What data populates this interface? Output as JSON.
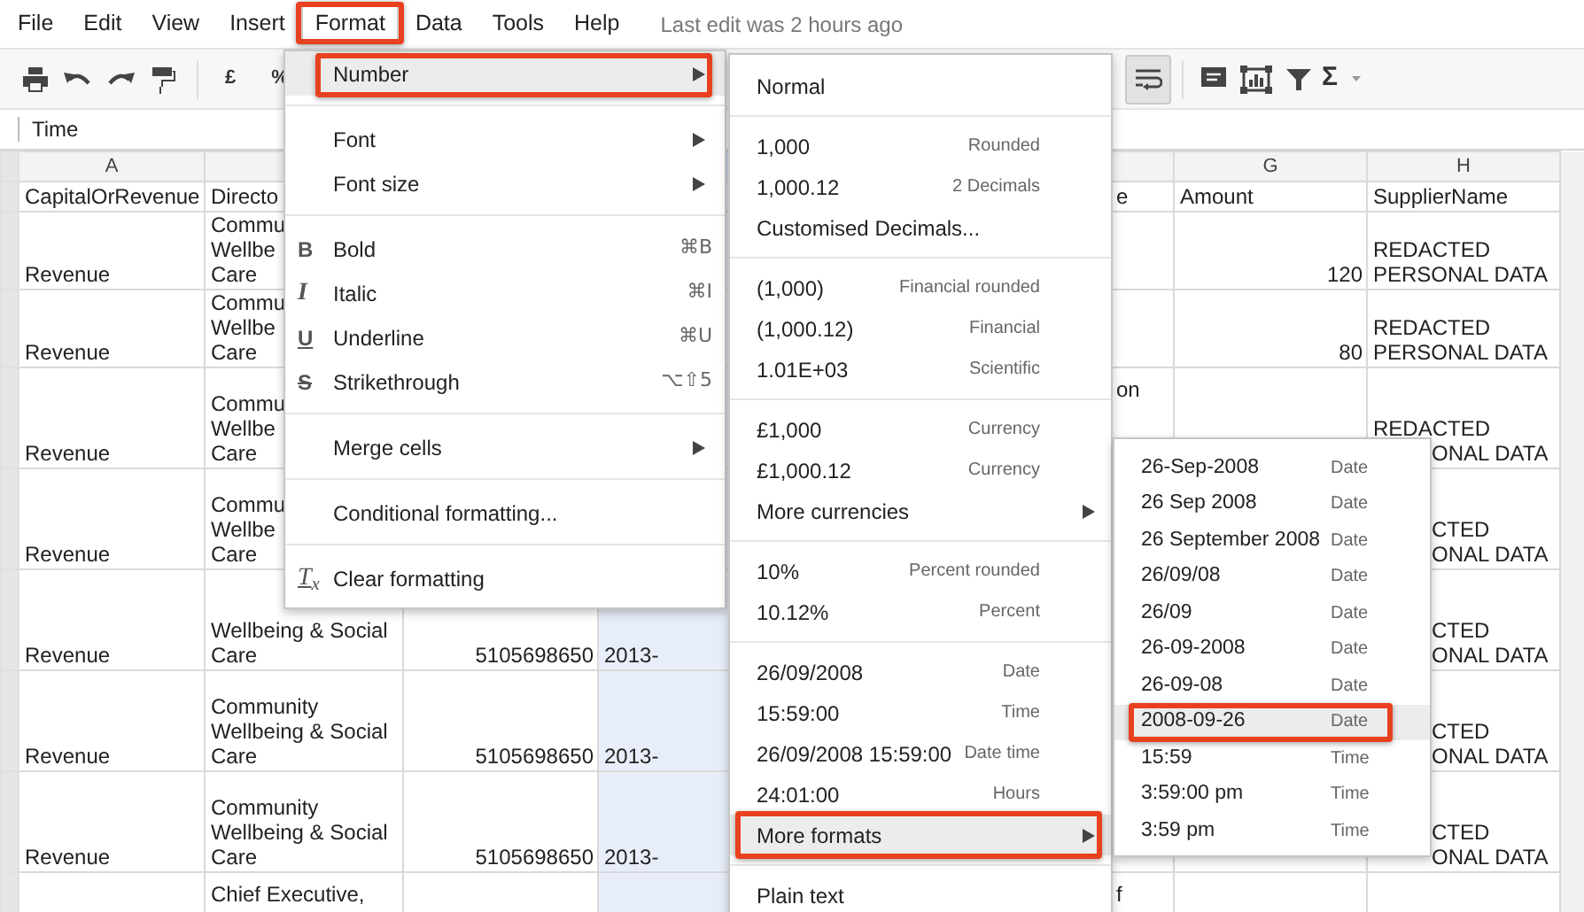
{
  "menubar": {
    "items": [
      {
        "label": "File",
        "selected": false,
        "annotated": false
      },
      {
        "label": "Edit",
        "selected": false,
        "annotated": false
      },
      {
        "label": "View",
        "selected": false,
        "annotated": false
      },
      {
        "label": "Insert",
        "selected": false,
        "annotated": false
      },
      {
        "label": "Format",
        "selected": true,
        "annotated": true
      },
      {
        "label": "Data",
        "selected": false,
        "annotated": false
      },
      {
        "label": "Tools",
        "selected": false,
        "annotated": false
      },
      {
        "label": "Help",
        "selected": false,
        "annotated": false
      }
    ],
    "status": "Last edit was 2 hours ago"
  },
  "toolbar": {
    "currency": "£",
    "percent": "%",
    "sum": "Σ",
    "wrap_selected": true
  },
  "formula_bar": {
    "value": "Time"
  },
  "sheet": {
    "columns": {
      "A": {
        "header": "A",
        "selected": false
      },
      "B": {
        "selected": false
      },
      "C": {
        "selected": false
      },
      "D": {
        "selected": true
      },
      "F": {
        "selected": false
      },
      "G": {
        "header": "G",
        "selected": false
      },
      "H": {
        "header": "H",
        "selected": false
      }
    },
    "rows": [
      {
        "cells": {
          "A": {
            "lines": [
              "CapitalOrRevenue"
            ]
          },
          "B": {
            "lines": [
              "Directo"
            ]
          },
          "F": {
            "lines": [
              "e"
            ]
          },
          "G": {
            "lines": [
              "Amount"
            ]
          },
          "H": {
            "lines": [
              "SupplierName"
            ]
          }
        }
      },
      {
        "cells": {
          "A": {
            "lines": [
              "Revenue"
            ]
          },
          "B": {
            "lines": [
              "Commu",
              "Wellbe",
              "Care"
            ]
          },
          "G": {
            "lines": [
              "120"
            ],
            "kind": "number"
          },
          "H": {
            "lines": [
              "REDACTED",
              "PERSONAL DATA"
            ]
          }
        }
      },
      {
        "cells": {
          "A": {
            "lines": [
              "Revenue"
            ]
          },
          "B": {
            "lines": [
              "Commu",
              "Wellbe",
              "Care"
            ]
          },
          "G": {
            "lines": [
              "80"
            ],
            "kind": "number"
          },
          "H": {
            "lines": [
              "REDACTED",
              "PERSONAL DATA"
            ]
          }
        }
      },
      {
        "cells": {
          "A": {
            "lines": [
              "Revenue"
            ]
          },
          "B": {
            "lines": [
              "Commu",
              "Wellbe",
              "Care"
            ]
          },
          "F": {
            "lines": [
              "on"
            ],
            "kind": "top"
          },
          "H": {
            "lines": [
              "REDACTED"
            ],
            "covered_lines": [
              "ONAL DATA"
            ]
          }
        }
      },
      {
        "cells": {
          "A": {
            "lines": [
              "Revenue"
            ]
          },
          "B": {
            "lines": [
              "Commu",
              "Wellbe",
              "Care"
            ]
          },
          "H": {
            "covered_lines": [
              "CTED",
              "ONAL DATA"
            ]
          }
        }
      },
      {
        "cells": {
          "A": {
            "lines": [
              "Revenue"
            ]
          },
          "B": {
            "lines": [
              "Wellbeing & Social",
              "Care"
            ]
          },
          "C": {
            "lines": [
              "5105698650"
            ],
            "kind": "number"
          },
          "D": {
            "lines": [
              "2013-"
            ]
          },
          "H": {
            "covered_lines": [
              "CTED",
              "ONAL DATA"
            ]
          }
        }
      },
      {
        "cells": {
          "A": {
            "lines": [
              "Revenue"
            ]
          },
          "B": {
            "lines": [
              "Community",
              "Wellbeing & Social",
              "Care"
            ]
          },
          "C": {
            "lines": [
              "5105698650"
            ],
            "kind": "number"
          },
          "D": {
            "lines": [
              "2013-"
            ]
          },
          "H": {
            "covered_lines": [
              "CTED",
              "ONAL DATA"
            ]
          }
        }
      },
      {
        "cells": {
          "A": {
            "lines": [
              "Revenue"
            ]
          },
          "B": {
            "lines": [
              "Community",
              "Wellbeing & Social",
              "Care"
            ]
          },
          "C": {
            "lines": [
              "5105698650"
            ],
            "kind": "number"
          },
          "D": {
            "lines": [
              "2013-"
            ]
          },
          "H": {
            "covered_lines": [
              "CTED",
              "ONAL DATA"
            ]
          }
        }
      },
      {
        "cells": {
          "B": {
            "lines": [
              "Chief Executive,"
            ],
            "kind": "top"
          },
          "F": {
            "lines": [
              "f"
            ],
            "kind": "top"
          }
        }
      }
    ]
  },
  "format_menu": {
    "sections": [
      [
        {
          "label": "Number",
          "submenu": true,
          "highlighted": true,
          "annotated": true
        }
      ],
      [
        {
          "label": "Font",
          "submenu": true,
          "highlighted": false,
          "annotated": false
        },
        {
          "label": "Font size",
          "submenu": true,
          "highlighted": false,
          "annotated": false
        }
      ],
      [
        {
          "label": "Bold",
          "kind": "bold",
          "glyph": "B",
          "shortcut": "⌘B",
          "submenu": false,
          "highlighted": false,
          "annotated": false
        },
        {
          "label": "Italic",
          "kind": "italic",
          "glyph": "I",
          "shortcut": "⌘I",
          "submenu": false,
          "highlighted": false,
          "annotated": false
        },
        {
          "label": "Underline",
          "kind": "underline",
          "glyph": "U",
          "shortcut": "⌘U",
          "submenu": false,
          "highlighted": false,
          "annotated": false
        },
        {
          "label": "Strikethrough",
          "kind": "strikethrough",
          "glyph": "S",
          "shortcut": "⌥⇧5",
          "submenu": false,
          "highlighted": false,
          "annotated": false
        }
      ],
      [
        {
          "label": "Merge cells",
          "submenu": true,
          "highlighted": false,
          "annotated": false
        }
      ],
      [
        {
          "label": "Conditional formatting...",
          "submenu": false,
          "highlighted": false,
          "annotated": false
        }
      ],
      [
        {
          "label": "Clear formatting",
          "kind": "clear",
          "glyph": "T$_{x}$",
          "submenu": false,
          "highlighted": false,
          "annotated": false
        }
      ]
    ]
  },
  "number_menu": {
    "sections": [
      [
        {
          "label": "Normal",
          "submenu": false,
          "highlighted": false,
          "annotated": false
        }
      ],
      [
        {
          "label": "1,000",
          "hint": "Rounded",
          "submenu": false,
          "highlighted": false,
          "annotated": false
        },
        {
          "label": "1,000.12",
          "hint": "2 Decimals",
          "submenu": false,
          "highlighted": false,
          "annotated": false
        },
        {
          "label": "Customised Decimals...",
          "submenu": false,
          "highlighted": false,
          "annotated": false
        }
      ],
      [
        {
          "label": "(1,000)",
          "hint": "Financial rounded",
          "submenu": false,
          "highlighted": false,
          "annotated": false
        },
        {
          "label": "(1,000.12)",
          "hint": "Financial",
          "submenu": false,
          "highlighted": false,
          "annotated": false
        },
        {
          "label": "1.01E+03",
          "hint": "Scientific",
          "submenu": false,
          "highlighted": false,
          "annotated": false
        }
      ],
      [
        {
          "label": "£1,000",
          "hint": "Currency",
          "submenu": false,
          "highlighted": false,
          "annotated": false
        },
        {
          "label": "£1,000.12",
          "hint": "Currency",
          "submenu": false,
          "highlighted": false,
          "annotated": false
        },
        {
          "label": "More currencies",
          "submenu": true,
          "highlighted": false,
          "annotated": false
        }
      ],
      [
        {
          "label": "10%",
          "hint": "Percent rounded",
          "submenu": false,
          "highlighted": false,
          "annotated": false
        },
        {
          "label": "10.12%",
          "hint": "Percent",
          "submenu": false,
          "highlighted": false,
          "annotated": false
        }
      ],
      [
        {
          "label": "26/09/2008",
          "hint": "Date",
          "submenu": false,
          "highlighted": false,
          "annotated": false
        },
        {
          "label": "15:59:00",
          "hint": "Time",
          "submenu": false,
          "highlighted": false,
          "annotated": false
        },
        {
          "label": "26/09/2008 15:59:00",
          "hint": "Date time",
          "submenu": false,
          "highlighted": false,
          "annotated": false
        },
        {
          "label": "24:01:00",
          "hint": "Hours",
          "submenu": false,
          "highlighted": false,
          "annotated": false
        },
        {
          "label": "More formats",
          "submenu": true,
          "highlighted": true,
          "annotated": true
        }
      ],
      [
        {
          "label": "Plain text",
          "submenu": false,
          "highlighted": false,
          "annotated": false
        }
      ]
    ]
  },
  "date_menu": {
    "sections": [
      [
        {
          "label": "26-Sep-2008",
          "hint": "Date",
          "submenu": false,
          "highlighted": false,
          "annotated": false
        },
        {
          "label": "26 Sep 2008",
          "hint": "Date",
          "submenu": false,
          "highlighted": false,
          "annotated": false
        },
        {
          "label": "26 September 2008",
          "hint": "Date",
          "submenu": false,
          "highlighted": false,
          "annotated": false
        },
        {
          "label": "26/09/08",
          "hint": "Date",
          "submenu": false,
          "highlighted": false,
          "annotated": false
        },
        {
          "label": "26/09",
          "hint": "Date",
          "submenu": false,
          "highlighted": false,
          "annotated": false
        },
        {
          "label": "26-09-2008",
          "hint": "Date",
          "submenu": false,
          "highlighted": false,
          "annotated": false
        },
        {
          "label": "26-09-08",
          "hint": "Date",
          "submenu": false,
          "highlighted": false,
          "annotated": false
        },
        {
          "label": "2008-09-26",
          "hint": "Date",
          "submenu": false,
          "highlighted": true,
          "annotated": true
        },
        {
          "label": "15:59",
          "hint": "Time",
          "submenu": false,
          "highlighted": false,
          "annotated": false
        },
        {
          "label": "3:59:00 pm",
          "hint": "Time",
          "submenu": false,
          "highlighted": false,
          "annotated": false
        },
        {
          "label": "3:59 pm",
          "hint": "Time",
          "submenu": false,
          "highlighted": false,
          "annotated": false
        }
      ]
    ]
  }
}
